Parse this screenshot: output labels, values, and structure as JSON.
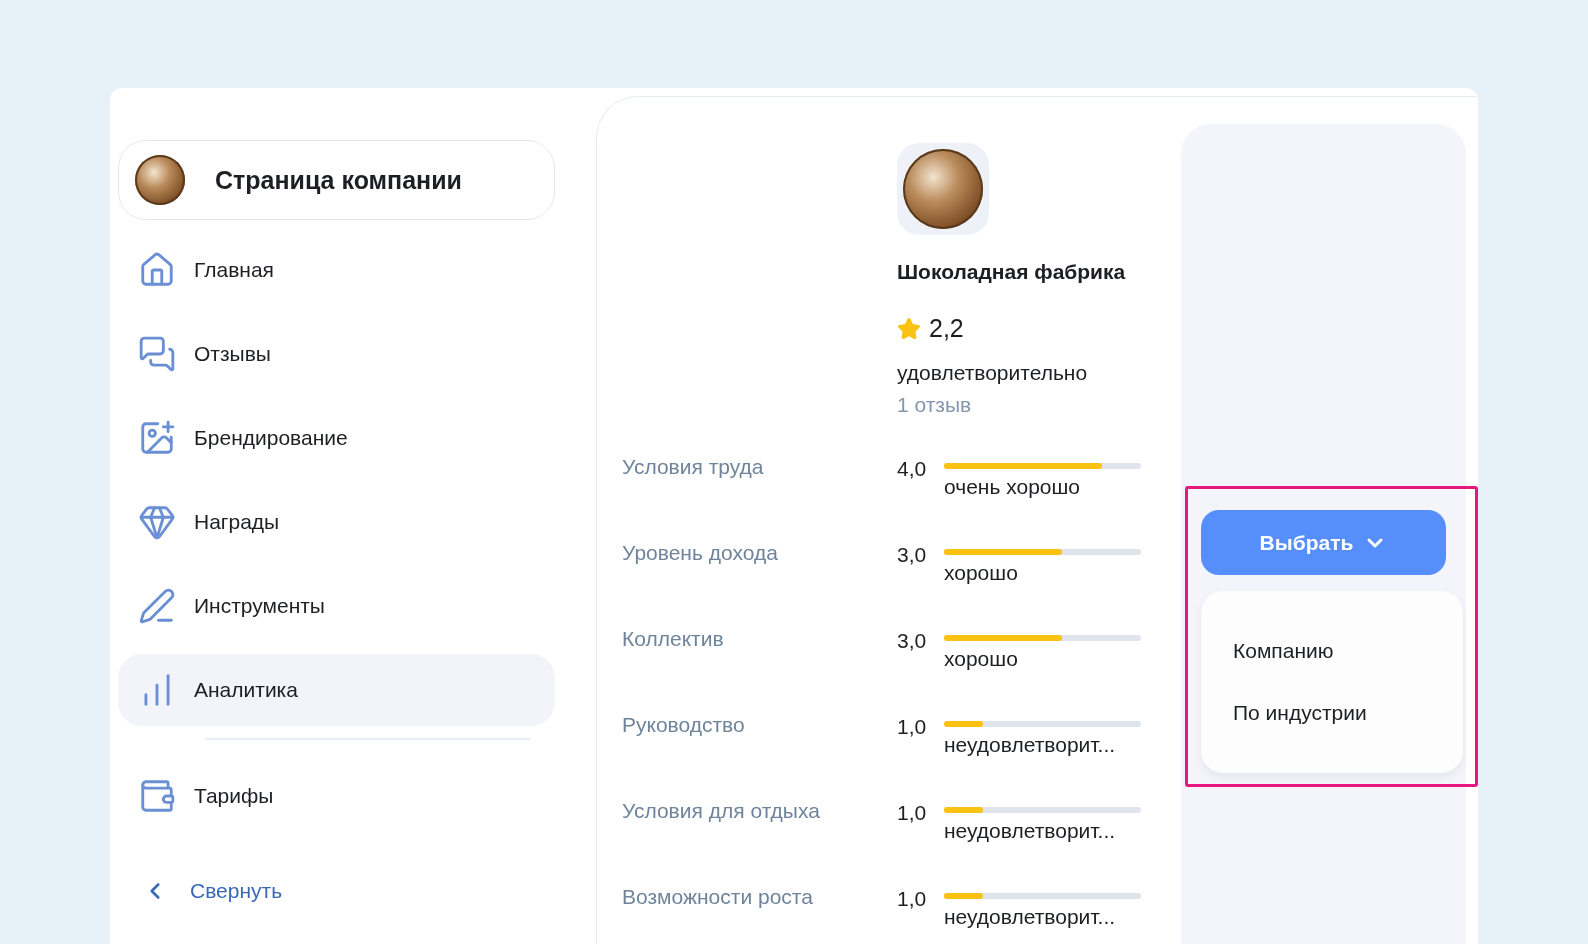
{
  "sidebar": {
    "company_title": "Страница компании",
    "items": [
      {
        "label": "Главная",
        "selected": false
      },
      {
        "label": "Отзывы",
        "selected": false
      },
      {
        "label": "Брендирование",
        "selected": false
      },
      {
        "label": "Награды",
        "selected": false
      },
      {
        "label": "Инструменты",
        "selected": false
      },
      {
        "label": "Аналитика",
        "selected": true
      }
    ],
    "extra_items": [
      {
        "label": "Тарифы",
        "selected": false
      }
    ],
    "collapse_link": "Свернуть"
  },
  "company": {
    "name": "Шоколадная фабрика",
    "rating": "2,2",
    "verdict": "удовлетворительно",
    "reviews": "1 отзыв"
  },
  "ratings": [
    {
      "label": "Условия труда",
      "score": "4,0",
      "level": 0.8,
      "verdict": "очень хорошо"
    },
    {
      "label": "Уровень дохода",
      "score": "3,0",
      "level": 0.6,
      "verdict": "хорошо"
    },
    {
      "label": "Коллектив",
      "score": "3,0",
      "level": 0.6,
      "verdict": "хорошо"
    },
    {
      "label": "Руководство",
      "score": "1,0",
      "level": 0.2,
      "verdict": "неудовлетворит..."
    },
    {
      "label": "Условия для отдыха",
      "score": "1,0",
      "level": 0.2,
      "verdict": "неудовлетворит..."
    },
    {
      "label": "Возможности роста",
      "score": "1,0",
      "level": 0.2,
      "verdict": "неудовлетворит..."
    }
  ],
  "select_button": {
    "label": "Выбрать",
    "expanded": true
  },
  "dropdown_options": [
    "Компанию",
    "По индустрии"
  ]
}
